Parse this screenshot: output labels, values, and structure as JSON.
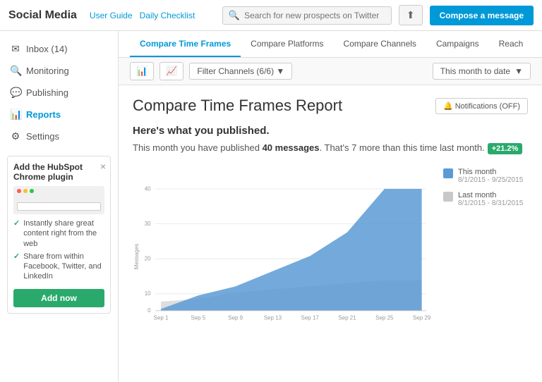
{
  "header": {
    "logo": "Social Media",
    "links": [
      "User Guide",
      "Daily Checklist"
    ],
    "search_placeholder": "Search for new prospects on Twitter",
    "cloud_icon": "☁",
    "compose_label": "Compose a message"
  },
  "sidebar": {
    "items": [
      {
        "id": "inbox",
        "label": "Inbox (14)",
        "icon": "✉",
        "active": false
      },
      {
        "id": "monitoring",
        "label": "Monitoring",
        "icon": "🔍",
        "active": false
      },
      {
        "id": "publishing",
        "label": "Publishing",
        "icon": "💬",
        "active": false
      },
      {
        "id": "reports",
        "label": "Reports",
        "icon": "📊",
        "active": true
      },
      {
        "id": "settings",
        "label": "Settings",
        "icon": "⚙",
        "active": false
      }
    ],
    "plugin_card": {
      "title": "Add the HubSpot Chrome plugin",
      "close_label": "×",
      "features": [
        "Instantly share great content right from the web",
        "Share from within Facebook, Twitter, and LinkedIn"
      ],
      "add_now_label": "Add now"
    }
  },
  "tabs": [
    {
      "label": "Compare Time Frames",
      "active": true
    },
    {
      "label": "Compare Platforms",
      "active": false
    },
    {
      "label": "Compare Channels",
      "active": false
    },
    {
      "label": "Campaigns",
      "active": false
    },
    {
      "label": "Reach",
      "active": false
    }
  ],
  "toolbar": {
    "bar_icon": "📊",
    "trend_icon": "📈",
    "filter_label": "Filter Channels (6/6) ▼",
    "date_label": "This month to date",
    "date_arrow": "▼"
  },
  "report": {
    "title": "Compare Time Frames Report",
    "notifications_label": "🔔 Notifications (OFF)",
    "subtitle": "Here's what you published.",
    "description_start": "This month you have published ",
    "highlight": "40 messages",
    "description_end": ". That's 7 more than this time last month.",
    "badge": "+21.2%"
  },
  "chart": {
    "y_label": "Messages",
    "y_max": 40,
    "y_ticks": [
      0,
      10,
      20,
      30,
      40
    ],
    "x_labels": [
      "Sep 1",
      "Sep 5",
      "Sep 9",
      "Sep 13",
      "Sep 17",
      "Sep 21",
      "Sep 25",
      "Sep 29"
    ],
    "legend": {
      "this_month_label": "This month",
      "this_month_dates": "8/1/2015 - 9/25/2015",
      "last_month_label": "Last month",
      "last_month_dates": "8/1/2015 - 8/31/2015"
    },
    "this_month_data": [
      1,
      5,
      8,
      13,
      18,
      26,
      40,
      40
    ],
    "last_month_data": [
      3,
      4,
      6,
      7,
      8,
      9,
      10,
      10
    ]
  }
}
